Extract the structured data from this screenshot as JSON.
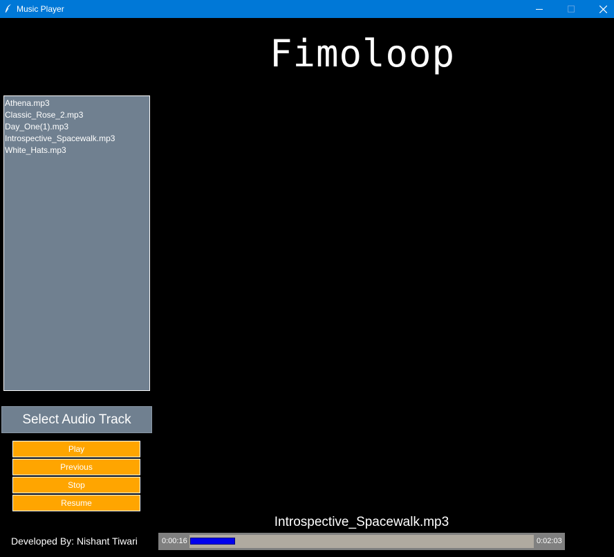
{
  "window": {
    "title": "Music Player",
    "titlebar_color": "#0078d7"
  },
  "app": {
    "title": "Fimoloop"
  },
  "playlist": {
    "background": "#708090",
    "items": [
      "Athena.mp3",
      "Classic_Rose_2.mp3",
      "Day_One(1).mp3",
      "Introspective_Spacewalk.mp3",
      "White_Hats.mp3"
    ]
  },
  "controls": {
    "select_label": "Select Audio Track",
    "play_label": "Play",
    "previous_label": "Previous",
    "stop_label": "Stop",
    "resume_label": "Resume",
    "button_color": "#ffa500"
  },
  "status": {
    "now_playing": "Introspective_Spacewalk.mp3",
    "developer": "Developed By: Nishant Tiwari"
  },
  "progress": {
    "elapsed": "0:00:16",
    "total": "0:02:03",
    "fraction": 0.13,
    "fill_color": "#0000ee"
  },
  "icons": {
    "app": "feather-icon",
    "minimize": "minimize-icon",
    "maximize": "maximize-icon",
    "close": "close-icon"
  }
}
